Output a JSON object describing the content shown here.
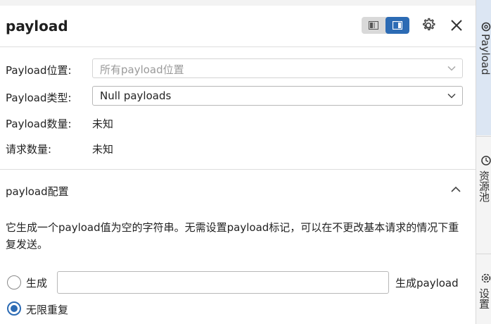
{
  "panel": {
    "title": "payload"
  },
  "form": {
    "position": {
      "label": "Payload位置:",
      "value": "所有payload位置"
    },
    "type": {
      "label": "Payload类型:",
      "value": "Null payloads"
    },
    "count": {
      "label": "Payload数量:",
      "value": "未知"
    },
    "requests": {
      "label": "请求数量:",
      "value": "未知"
    }
  },
  "config": {
    "title": "payload配置",
    "description": "它生成一个payload值为空的字符串。无需设置payload标记，可以在不更改基本请求的情况下重复发送。",
    "options": [
      {
        "label": "生成",
        "checked": false,
        "input_value": "",
        "suffix": "生成payload"
      },
      {
        "label": "无限重复",
        "checked": true
      }
    ]
  },
  "right_tabs": [
    {
      "label": "Payload",
      "active": true
    },
    {
      "label": "资源池",
      "active": false
    },
    {
      "label": "设置",
      "active": false
    }
  ],
  "colors": {
    "accent": "#2c6bb4",
    "active_tab": "#dce6f3",
    "divider": "#dedede"
  }
}
